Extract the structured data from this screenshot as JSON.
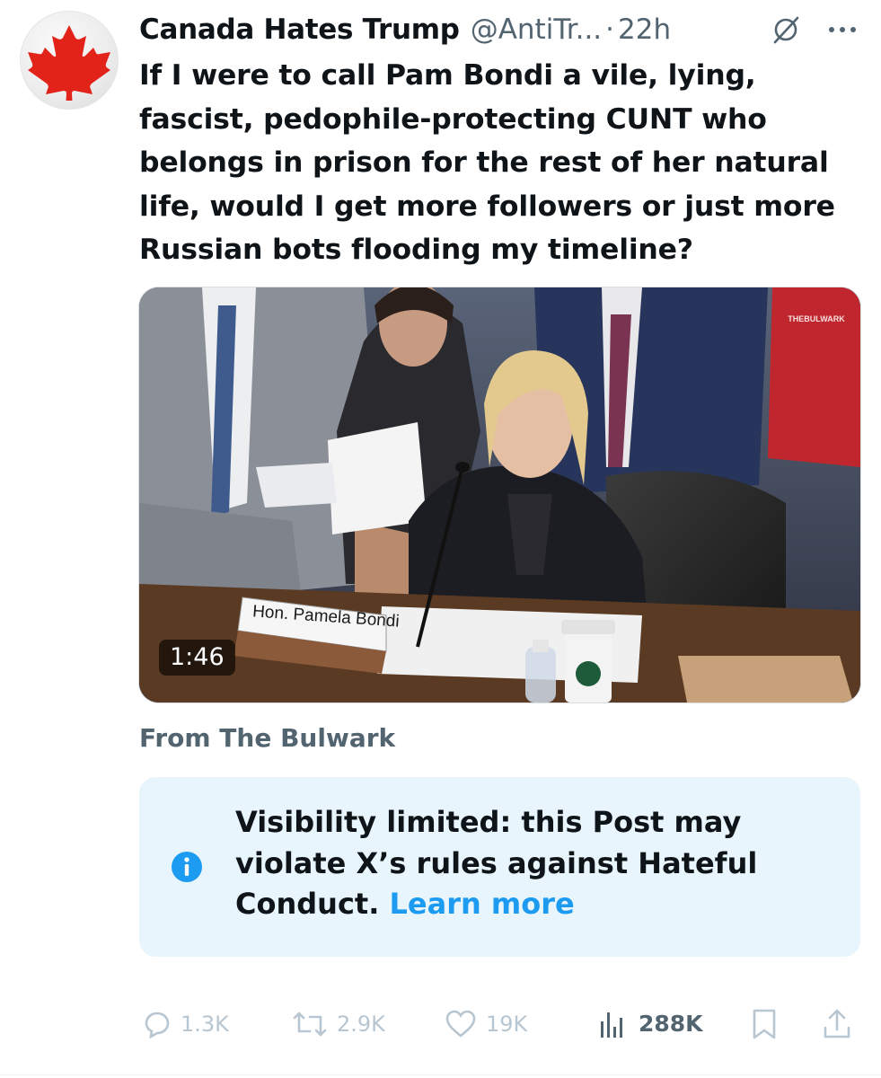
{
  "author": {
    "display_name": "Canada Hates Trump",
    "handle": "@AntiTr...",
    "separator": "·",
    "time": "22h",
    "avatar_icon": "maple-leaf-icon"
  },
  "tweet": {
    "text": "If I were to call Pam Bondi a vile, lying, fascist, pedophile-protecting CUNT who belongs in prison for the rest of her natural life, would I get more followers or just more Russian bots flooding my timeline?"
  },
  "media": {
    "type": "video",
    "duration": "1:46",
    "nameplate": "Hon. Pamela Bondi",
    "watermark": "THEBULWARK"
  },
  "source_label": "From The Bulwark",
  "notice": {
    "icon": "info-icon",
    "text": "Visibility limited: this Post may violate X’s rules against Hateful Conduct.",
    "link_text": "Learn more",
    "link_color": "#1d9bf0"
  },
  "actions": {
    "replies": "1.3K",
    "reposts": "2.9K",
    "likes": "19K",
    "views": "288K"
  },
  "colors": {
    "accent": "#1d9bf0",
    "secondary_text": "#536471",
    "notice_bg": "#e8f5fd",
    "maple_red": "#e2231a"
  }
}
